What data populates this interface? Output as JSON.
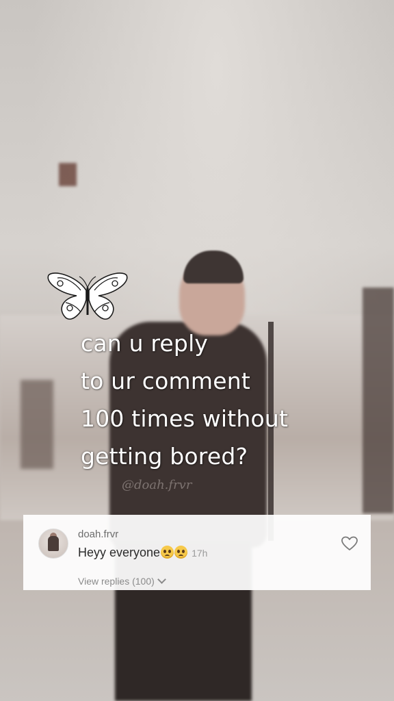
{
  "overlay": {
    "caption_lines": [
      "can u reply",
      "to ur comment",
      "100 times without",
      "getting bored?"
    ],
    "watermark": "@doah.frvr",
    "sticker_icon": "butterfly-icon"
  },
  "comment": {
    "username": "doah.frvr",
    "text": "Heyy everyone",
    "emojis": [
      "pleading-face-icon",
      "pleading-face-icon"
    ],
    "timestamp": "17h",
    "view_replies_label": "View replies (100)",
    "like_icon": "heart-outline-icon",
    "avatar_icon": "avatar"
  },
  "colors": {
    "caption_text": "#ffffff",
    "card_background": "#ffffff",
    "username": "#6c6c6c",
    "comment_text": "#2b2b2b",
    "muted": "#8a8a8a"
  }
}
